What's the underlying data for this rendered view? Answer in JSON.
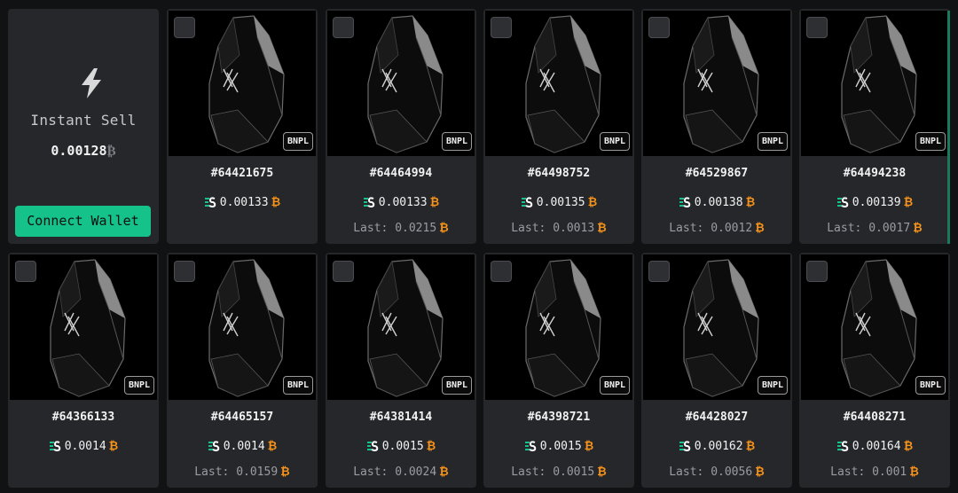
{
  "instant_sell": {
    "icon": "lightning-bolt-icon",
    "title": "Instant Sell",
    "price": "0.00128",
    "currency_symbol": "₿",
    "button_label": "Connect Wallet",
    "accent": "#14c28a"
  },
  "badge_label": "BNPL",
  "currency_symbol": "₿",
  "last_label": "Last:",
  "marketplace_icon": "marketplace-logo-icon",
  "cards": [
    {
      "id": "#64421675",
      "price": "0.00133",
      "last": ""
    },
    {
      "id": "#64464994",
      "price": "0.00133",
      "last": "0.0215"
    },
    {
      "id": "#64498752",
      "price": "0.00135",
      "last": "0.0013"
    },
    {
      "id": "#64529867",
      "price": "0.00138",
      "last": "0.0012"
    },
    {
      "id": "#64494238",
      "price": "0.00139",
      "last": "0.0017"
    },
    {
      "id": "#64366133",
      "price": "0.0014",
      "last": ""
    },
    {
      "id": "#64465157",
      "price": "0.0014",
      "last": "0.0159"
    },
    {
      "id": "#64381414",
      "price": "0.0015",
      "last": "0.0024"
    },
    {
      "id": "#64398721",
      "price": "0.0015",
      "last": "0.0015"
    },
    {
      "id": "#64428027",
      "price": "0.00162",
      "last": "0.0056"
    },
    {
      "id": "#64408271",
      "price": "0.00164",
      "last": "0.001"
    }
  ]
}
